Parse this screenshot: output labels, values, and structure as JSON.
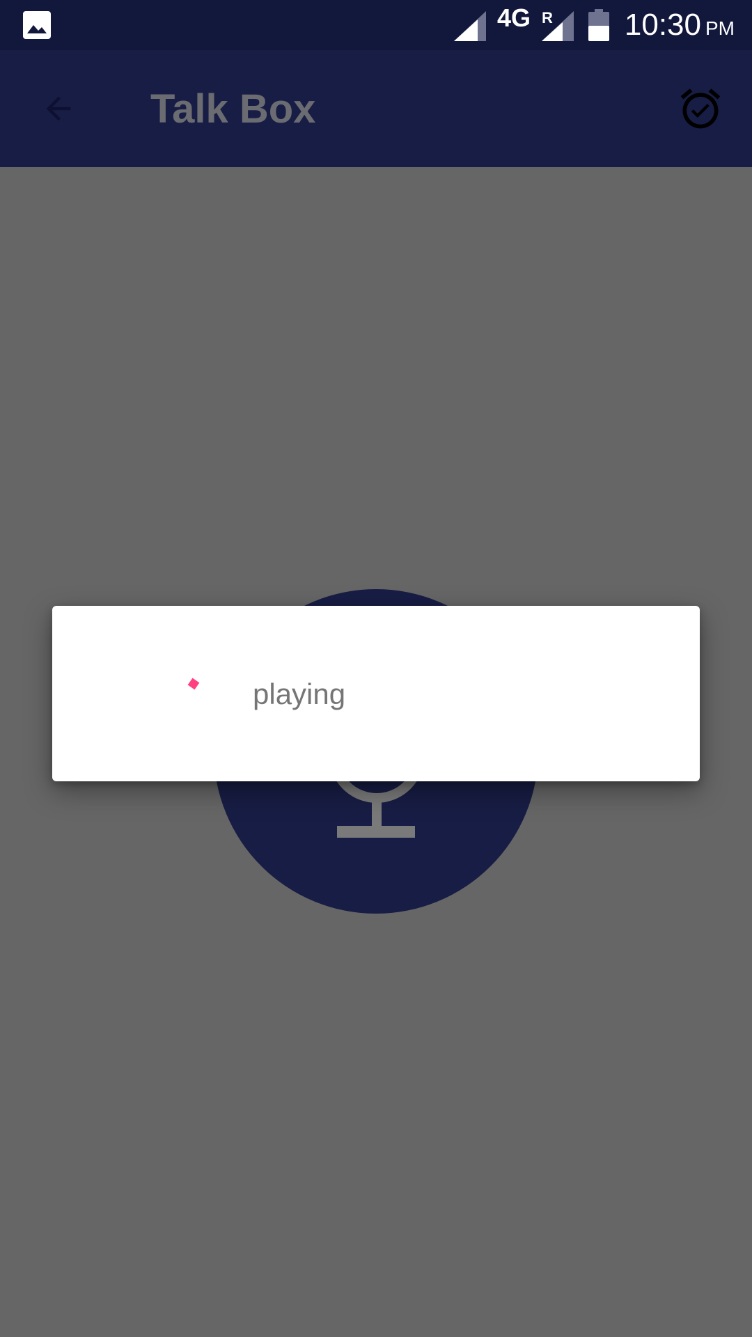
{
  "status_bar": {
    "network_type": "4G",
    "roaming_indicator": "R",
    "time": "10:30",
    "time_suffix": "PM",
    "icons": [
      "gallery-icon",
      "signal-icon",
      "signal-icon",
      "battery-icon"
    ]
  },
  "app_bar": {
    "title": "Talk Box",
    "icons": [
      "arrow-back-icon",
      "alarm-check-icon"
    ]
  },
  "main": {
    "center_button_icon": "microphone-icon"
  },
  "dialog": {
    "message": "playing",
    "indicator_icon": "progress-spinner-icon"
  },
  "colors": {
    "status_bar": "#12173c",
    "app_bar": "#181d45",
    "title_text": "#6b6b72",
    "scrim_background": "#666666",
    "mic_button": "#181d45",
    "spinner_accent": "#ff4081",
    "dialog_background": "#ffffff",
    "dialog_text": "#757575"
  }
}
